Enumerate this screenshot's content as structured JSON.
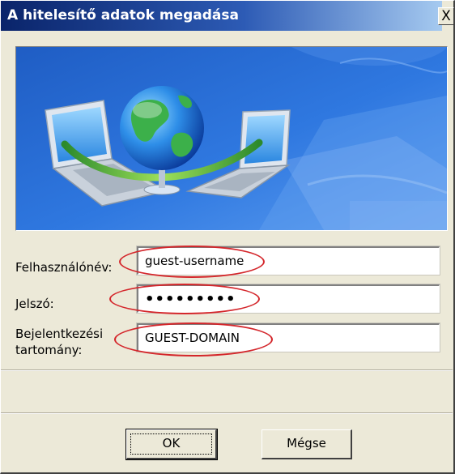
{
  "dialog": {
    "title": "A hitelesítő adatok megadása",
    "close_label": "X"
  },
  "banner": {
    "icon": "network-globe-laptops-icon"
  },
  "form": {
    "username_label": "Felhasználónév:",
    "username_value": "guest-username",
    "password_label": "Jelszó:",
    "password_value": "•••••••••",
    "domain_label_line1": "Bejelentkezési",
    "domain_label_line2": "tartomány:",
    "domain_value": "GUEST-DOMAIN"
  },
  "buttons": {
    "ok_label": "OK",
    "cancel_label": "Mégse"
  },
  "colors": {
    "title_bar": "#0a246a",
    "dialog_face": "#ece9d8",
    "annotation_circle": "#d4262b"
  }
}
